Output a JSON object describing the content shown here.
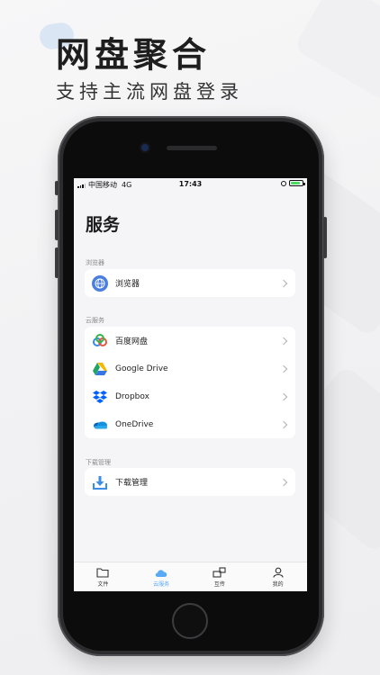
{
  "promo": {
    "headline": "网盘聚合",
    "subline": "支持主流网盘登录"
  },
  "status_bar": {
    "carrier": "中国移动",
    "network": "4G",
    "time": "17:43"
  },
  "page": {
    "title": "服务"
  },
  "sections": {
    "browser": {
      "label": "浏览器",
      "items": [
        {
          "label": "浏览器",
          "icon": "globe-icon"
        }
      ]
    },
    "cloud": {
      "label": "云服务",
      "items": [
        {
          "label": "百度网盘",
          "icon": "baidu-netdisk-icon"
        },
        {
          "label": "Google Drive",
          "icon": "google-drive-icon"
        },
        {
          "label": "Dropbox",
          "icon": "dropbox-icon"
        },
        {
          "label": "OneDrive",
          "icon": "onedrive-icon"
        }
      ]
    },
    "download": {
      "label": "下载管理",
      "items": [
        {
          "label": "下载管理",
          "icon": "download-tray-icon"
        }
      ]
    }
  },
  "tabbar": {
    "tabs": [
      {
        "label": "文件",
        "icon": "folder-icon",
        "active": false
      },
      {
        "label": "云服务",
        "icon": "cloud-icon",
        "active": true
      },
      {
        "label": "互传",
        "icon": "transfer-icon",
        "active": false
      },
      {
        "label": "我的",
        "icon": "person-icon",
        "active": false
      }
    ]
  },
  "colors": {
    "accent": "#5aa9f5",
    "battery": "#4cd964"
  }
}
